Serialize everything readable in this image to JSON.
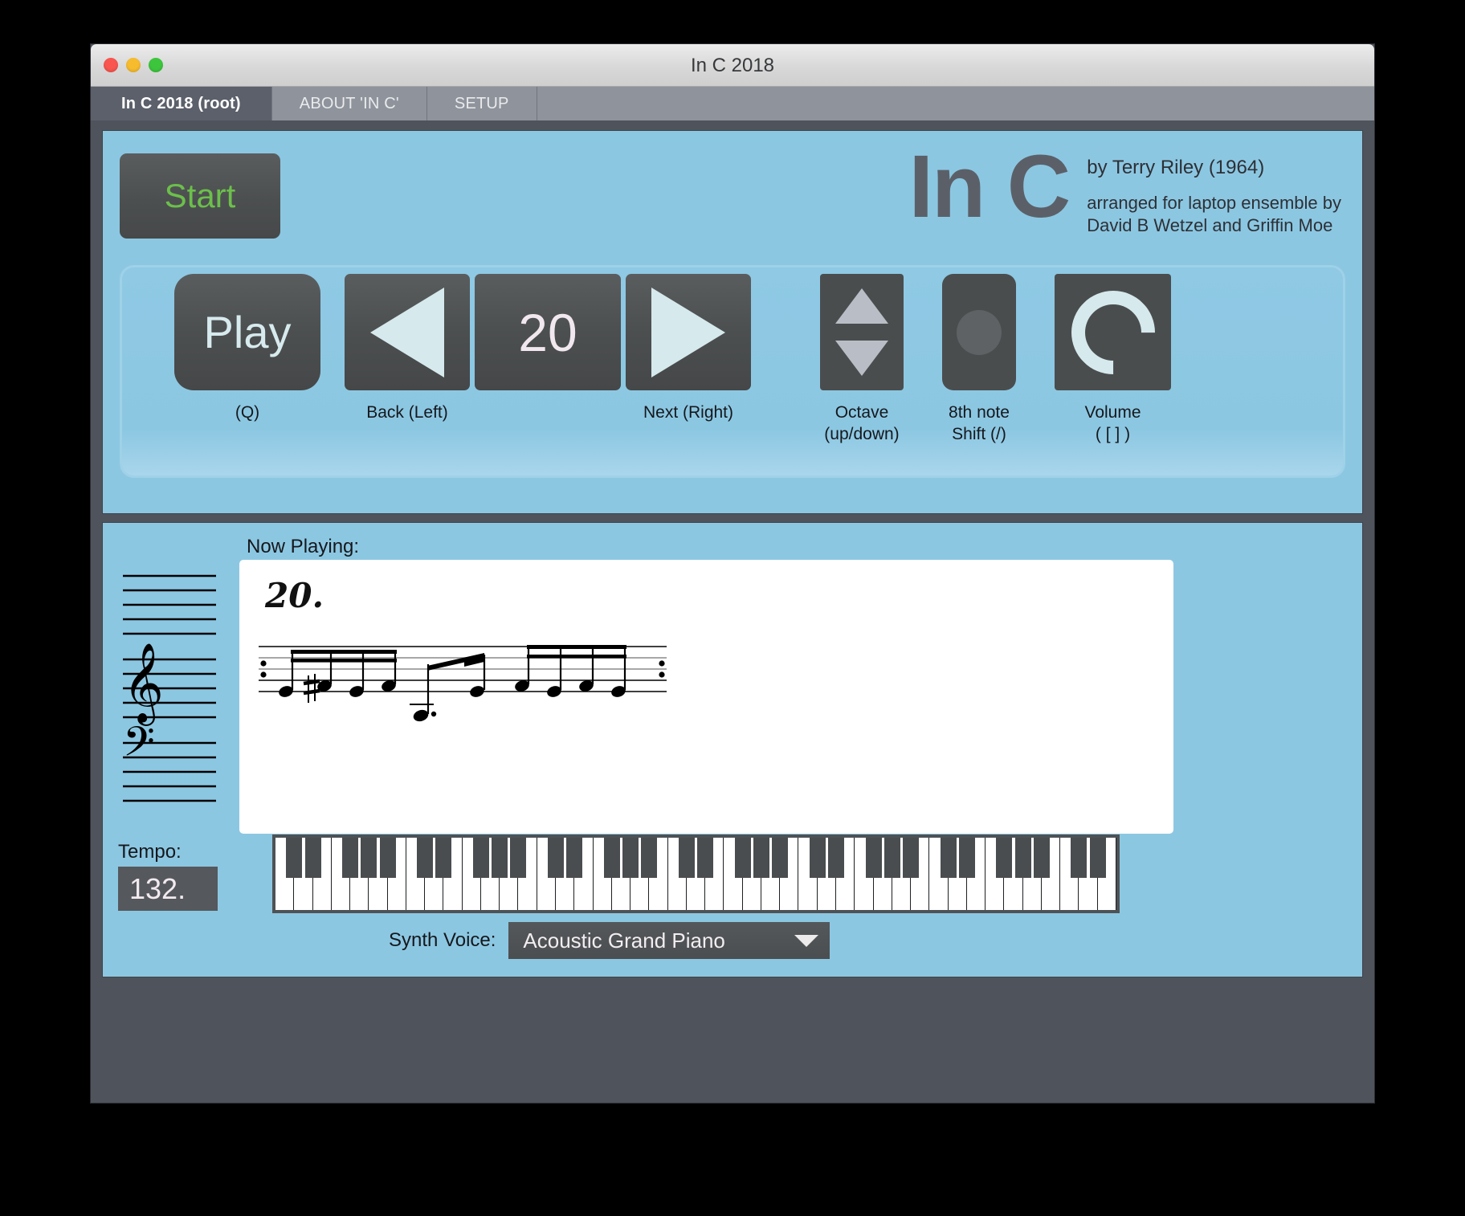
{
  "window": {
    "title": "In C 2018",
    "traffic_lights": [
      "close",
      "minimize",
      "zoom"
    ]
  },
  "tabs": [
    {
      "label": "In C 2018 (root)",
      "active": true
    },
    {
      "label": "ABOUT 'IN C'",
      "active": false
    },
    {
      "label": "SETUP",
      "active": false
    }
  ],
  "header": {
    "start_label": "Start",
    "big_title": "In C",
    "credit_line": "by Terry Riley (1964)",
    "arranged_line1": "arranged for laptop ensemble by",
    "arranged_line2": "David B Wetzel and Griffin Moe"
  },
  "transport": {
    "play_label": "Play",
    "play_key": "(Q)",
    "back_key": "Back (Left)",
    "pattern_number": "20",
    "next_key": "Next (Right)",
    "octave_label": "Octave\n(up/down)",
    "shift_label": "8th note\nShift (/)",
    "volume_label": "Volume\n( [ ] )"
  },
  "player": {
    "now_playing_label": "Now Playing:",
    "score_number": "20.",
    "tempo_label": "Tempo:",
    "tempo_value": "132.",
    "synth_label": "Synth Voice:",
    "synth_value": "Acoustic Grand Piano"
  },
  "colors": {
    "panel_blue": "#8cc7e2",
    "window_chrome": "#4e535c",
    "tab_inactive": "#8f949c",
    "tab_active": "#5b606a",
    "button_dark": "#4c4f50",
    "start_green": "#6cbf4b",
    "accent_pale": "#d6e9ed"
  }
}
